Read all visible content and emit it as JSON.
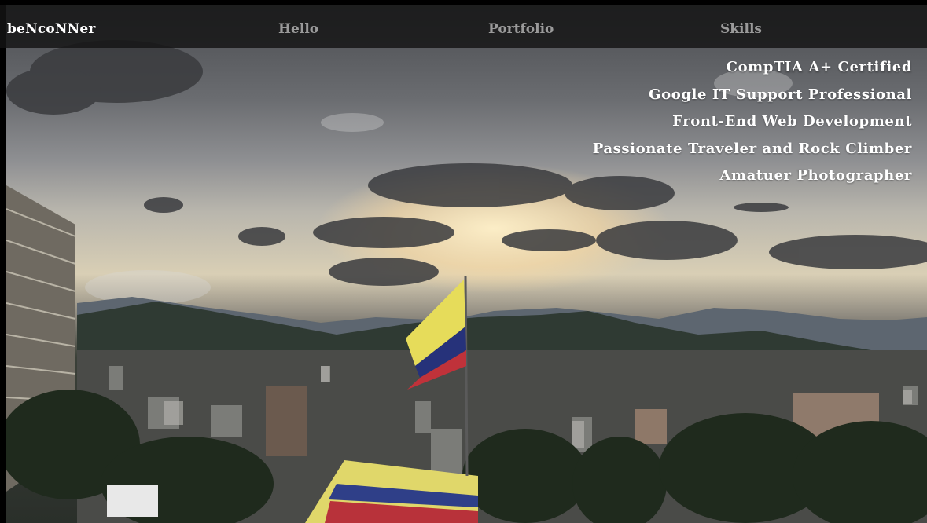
{
  "nav": {
    "brand": "beNcoNNer",
    "links": [
      "Hello",
      "Portfolio",
      "Skills"
    ]
  },
  "skills": [
    "CompTIA A+ Certified",
    "Google IT Support Professional",
    "Front-End Web Development",
    "Passionate Traveler and Rock Climber",
    "Amatuer Photographer"
  ],
  "colors": {
    "navbar_bg": "#141414",
    "brand_text": "#ffffff",
    "nav_link_text": "#9a9a9a",
    "skill_text": "#ffffff"
  }
}
